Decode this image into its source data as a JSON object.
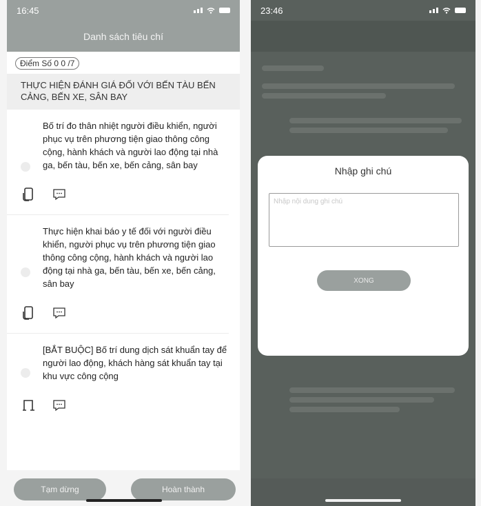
{
  "left_screen": {
    "status": {
      "time": "16:45"
    },
    "header": {
      "title": "Danh sách tiêu chí"
    },
    "score": "Điểm Số 0 0 /7",
    "section_title": "THỰC HIỆN ĐÁNH GIÁ ĐỐI VỚI BẾN TÀU BẾN CẢNG, BẾN XE, SÂN BAY",
    "criteria": [
      {
        "text": "Bố trí đo thân nhiệt người điều khiển, người phục vụ trên phương tiện giao thông công cộng, hành khách và người lao động tại nhà ga, bến tàu, bến xe, bến cảng, sân bay"
      },
      {
        "text": "Thực hiện khai báo y tế đối với người điều khiển, người phục vụ trên phương tiện giao thông công cộng, hành khách và người lao động tại nhà ga, bến tàu, bến xe, bến cảng, sân bay"
      },
      {
        "text": "[BẮT BUỘC] Bố trí dung dịch sát khuẩn tay để người lao động, khách hàng sát khuẩn tay tại khu vực công cộng"
      }
    ],
    "buttons": {
      "pause": "Tạm dừng",
      "finish": "Hoàn thành"
    }
  },
  "right_screen": {
    "status": {
      "time": "23:46"
    },
    "dialog": {
      "title": "Nhập ghi chú",
      "placeholder": "Nhập nội dung ghi chú",
      "done_button": "XONG"
    }
  },
  "colors": {
    "header": "#9aa09e",
    "overlay": "#59605c",
    "background": "#ffffff"
  }
}
